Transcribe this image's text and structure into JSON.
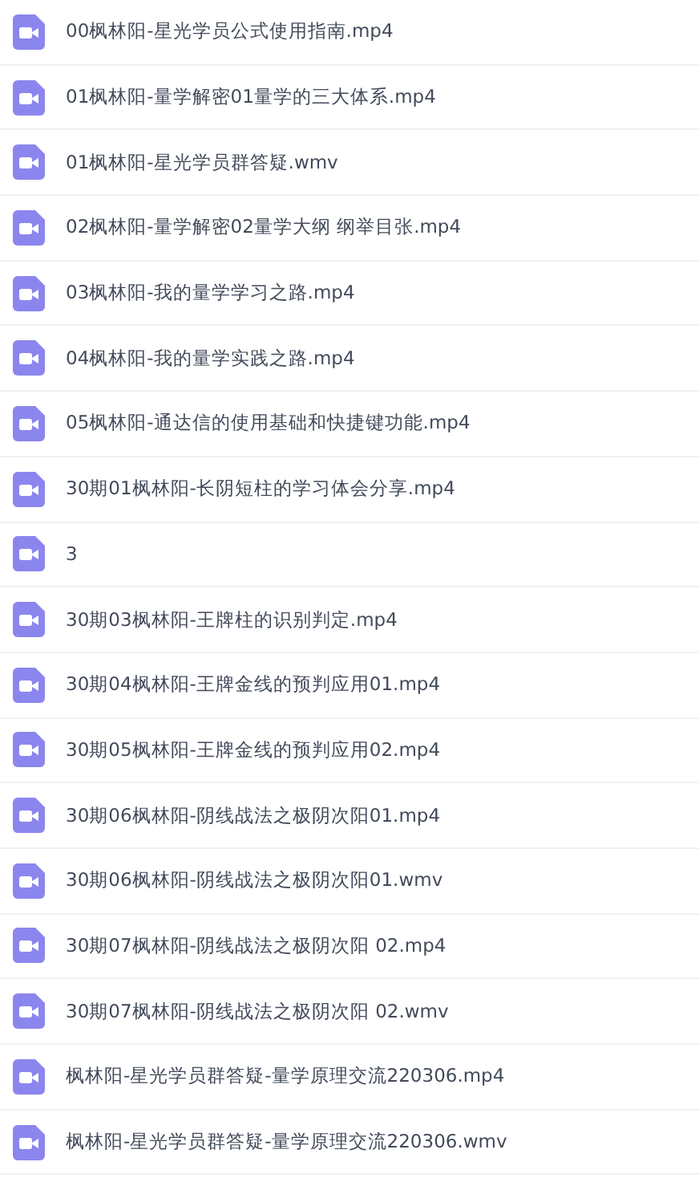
{
  "files": [
    {
      "name": "00枫林阳-星光学员公式使用指南.mp4"
    },
    {
      "name": "01枫林阳-量学解密01量学的三大体系.mp4"
    },
    {
      "name": "01枫林阳-星光学员群答疑.wmv"
    },
    {
      "name": "02枫林阳-量学解密02量学大纲 纲举目张.mp4"
    },
    {
      "name": "03枫林阳-我的量学学习之路.mp4"
    },
    {
      "name": "04枫林阳-我的量学实践之路.mp4"
    },
    {
      "name": "05枫林阳-通达信的使用基础和快捷键功能.mp4"
    },
    {
      "name": "30期01枫林阳-长阴短柱的学习体会分享.mp4"
    },
    {
      "name": "3"
    },
    {
      "name": "30期03枫林阳-王牌柱的识别判定.mp4"
    },
    {
      "name": "30期04枫林阳-王牌金线的预判应用01.mp4"
    },
    {
      "name": "30期05枫林阳-王牌金线的预判应用02.mp4"
    },
    {
      "name": "30期06枫林阳-阴线战法之极阴次阳01.mp4"
    },
    {
      "name": "30期06枫林阳-阴线战法之极阴次阳01.wmv"
    },
    {
      "name": "30期07枫林阳-阴线战法之极阴次阳 02.mp4"
    },
    {
      "name": "30期07枫林阳-阴线战法之极阴次阳 02.wmv"
    },
    {
      "name": "枫林阳-星光学员群答疑-量学原理交流220306.mp4"
    },
    {
      "name": "枫林阳-星光学员群答疑-量学原理交流220306.wmv"
    }
  ]
}
